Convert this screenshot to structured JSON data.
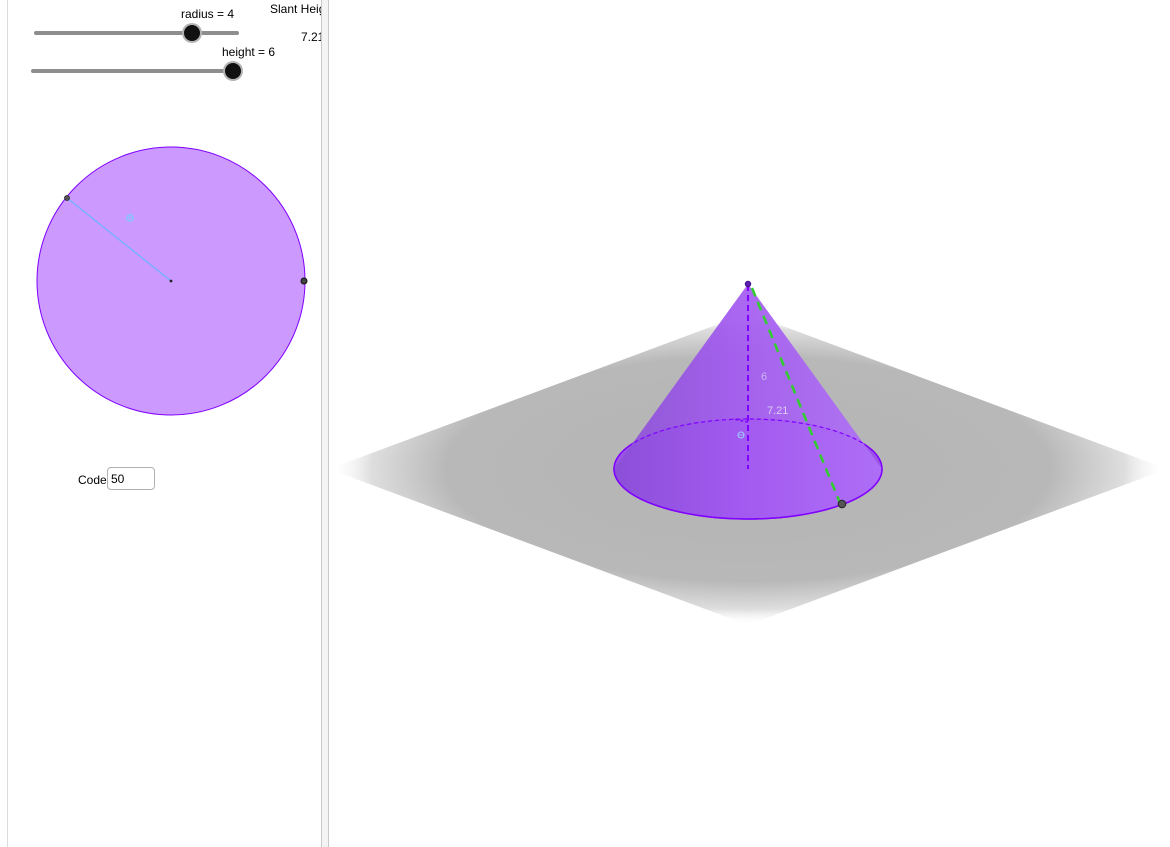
{
  "sliders": {
    "radius": {
      "label": "radius = 4",
      "value": 4
    },
    "height": {
      "label": "height = 6",
      "value": 6
    }
  },
  "slant_height": {
    "label": "Slant Height",
    "value": "7.21"
  },
  "code": {
    "label": "Code",
    "value": "50"
  },
  "cone3d": {
    "height_label": "6",
    "slant_label": "7.21"
  },
  "colors": {
    "cone_fill": "#a259f0",
    "circle_fill": "#cc99ff",
    "circle_stroke": "#7f00ff",
    "radius_line": "#6fb3ff",
    "slant_line": "#33cc33",
    "ground": "#b4b4b4"
  }
}
